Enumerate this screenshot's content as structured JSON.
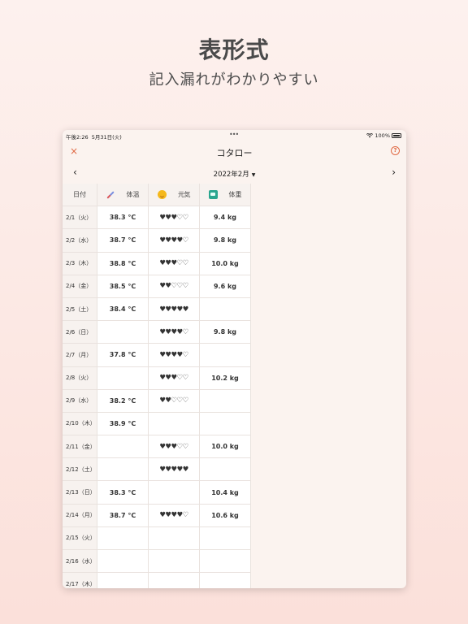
{
  "hero": {
    "title": "表形式",
    "subtitle": "記入漏れがわかりやすい"
  },
  "statusbar": {
    "time": "午後2:26",
    "date": "5月31日(火)",
    "battery": "100%"
  },
  "nav": {
    "title": "コタロー",
    "close_icon": "×",
    "help_icon": "?"
  },
  "month": {
    "label": "2022年2月",
    "prev": "‹",
    "next": "›"
  },
  "table": {
    "headers": {
      "date": "日付",
      "temp": "体温",
      "mood": "元気",
      "weight": "体重"
    },
    "rows": [
      {
        "date": "2/1（火）",
        "temp": "38.3 °C",
        "mood": "♥♥♥♡♡",
        "weight": "9.4 kg"
      },
      {
        "date": "2/2（水）",
        "temp": "38.7 °C",
        "mood": "♥♥♥♥♡",
        "weight": "9.8 kg"
      },
      {
        "date": "2/3（木）",
        "temp": "38.8 °C",
        "mood": "♥♥♥♡♡",
        "weight": "10.0 kg"
      },
      {
        "date": "2/4（金）",
        "temp": "38.5 °C",
        "mood": "♥♥♡♡♡",
        "weight": "9.6 kg"
      },
      {
        "date": "2/5（土）",
        "temp": "38.4 °C",
        "mood": "♥♥♥♥♥",
        "weight": ""
      },
      {
        "date": "2/6（日）",
        "temp": "",
        "mood": "♥♥♥♥♡",
        "weight": "9.8 kg"
      },
      {
        "date": "2/7（月）",
        "temp": "37.8 °C",
        "mood": "♥♥♥♥♡",
        "weight": ""
      },
      {
        "date": "2/8（火）",
        "temp": "",
        "mood": "♥♥♥♡♡",
        "weight": "10.2 kg"
      },
      {
        "date": "2/9（水）",
        "temp": "38.2 °C",
        "mood": "♥♥♡♡♡",
        "weight": ""
      },
      {
        "date": "2/10（木）",
        "temp": "38.9 °C",
        "mood": "",
        "weight": ""
      },
      {
        "date": "2/11（金）",
        "temp": "",
        "mood": "♥♥♥♡♡",
        "weight": "10.0 kg"
      },
      {
        "date": "2/12（土）",
        "temp": "",
        "mood": "♥♥♥♥♥",
        "weight": ""
      },
      {
        "date": "2/13（日）",
        "temp": "38.3 °C",
        "mood": "",
        "weight": "10.4 kg"
      },
      {
        "date": "2/14（月）",
        "temp": "38.7 °C",
        "mood": "♥♥♥♥♡",
        "weight": "10.6 kg"
      },
      {
        "date": "2/15（火）",
        "temp": "",
        "mood": "",
        "weight": ""
      },
      {
        "date": "2/16（水）",
        "temp": "",
        "mood": "",
        "weight": ""
      },
      {
        "date": "2/17（木）",
        "temp": "",
        "mood": "",
        "weight": ""
      }
    ]
  },
  "colors": {
    "accent": "#e06a45",
    "mood_icon": "#f5b81c",
    "weight_icon": "#2aa68f"
  }
}
